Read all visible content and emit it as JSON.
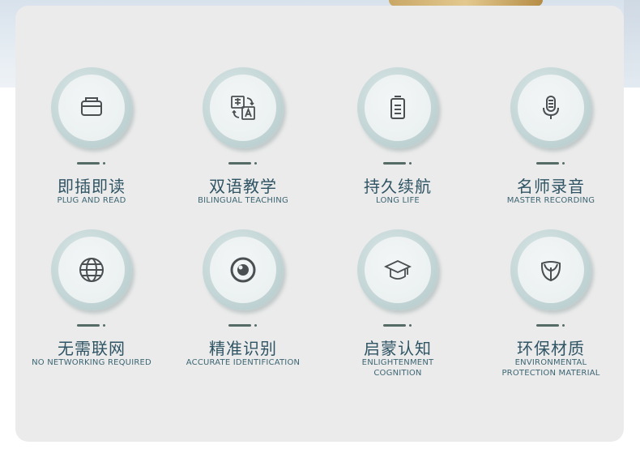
{
  "features": [
    {
      "title": "即插即读",
      "subtitle": "PLUG AND READ",
      "icon": "usb-plug-icon"
    },
    {
      "title": "双语教学",
      "subtitle": "BILINGUAL TEACHING",
      "icon": "translate-icon"
    },
    {
      "title": "持久续航",
      "subtitle": "LONG LIFE",
      "icon": "battery-icon"
    },
    {
      "title": "名师录音",
      "subtitle": "MASTER RECORDING",
      "icon": "microphone-icon"
    },
    {
      "title": "无需联网",
      "subtitle": "NO NETWORKING REQUIRED",
      "icon": "globe-icon"
    },
    {
      "title": "精准识别",
      "subtitle": "ACCURATE IDENTIFICATION",
      "icon": "target-eye-icon"
    },
    {
      "title": "启蒙认知",
      "subtitle": "ENLIGHTENMENT\nCOGNITION",
      "icon": "graduation-cap-icon"
    },
    {
      "title": "环保材质",
      "subtitle": "ENVIRONMENTAL\nPROTECTION MATERIAL",
      "icon": "leaf-sprout-icon"
    }
  ],
  "colors": {
    "title": "#2f5464",
    "subtitle": "#3c6573",
    "icon": "#4a4f52",
    "accent": "#546b66"
  }
}
